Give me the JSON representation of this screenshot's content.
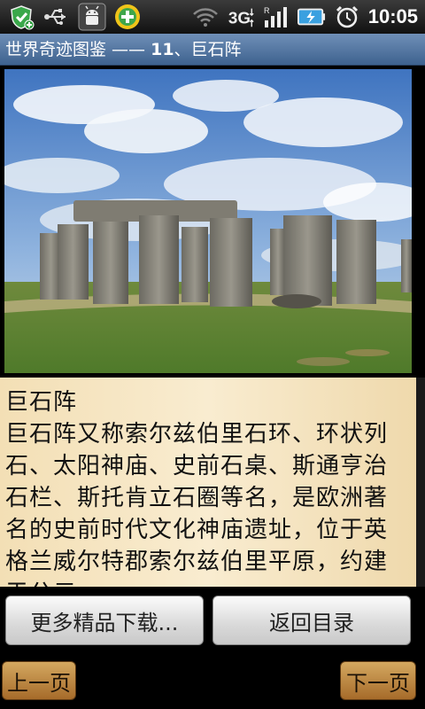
{
  "status_bar": {
    "time": "10:05",
    "icons_left": [
      "shield-update-icon",
      "usb-icon",
      "android-debug-icon",
      "360-security-icon"
    ],
    "icons_right": [
      "wifi-icon",
      "3g-data-icon",
      "signal-icon",
      "battery-charging-icon",
      "alarm-icon"
    ]
  },
  "title_bar": {
    "prefix": "世界奇迹图鉴 —— ",
    "number": "11",
    "suffix": "、巨石阵"
  },
  "article": {
    "heading": "巨石阵",
    "body": "巨石阵又称索尔兹伯里石环、环状列石、太阳神庙、史前石桌、斯通亨治石栏、斯托肯立石圈等名，是欧洲著名的史前时代文化神庙遗址，位于英格兰威尔特郡索尔兹伯里平原，约建于公元"
  },
  "buttons": {
    "more_downloads": "更多精品下载...",
    "back_to_index": "返回目录",
    "prev_page": "上一页",
    "next_page": "下一页"
  },
  "colors": {
    "title_bar": "#4f73a0",
    "text_panel": "#f6e6c4",
    "nav_button": "#b97d37"
  }
}
